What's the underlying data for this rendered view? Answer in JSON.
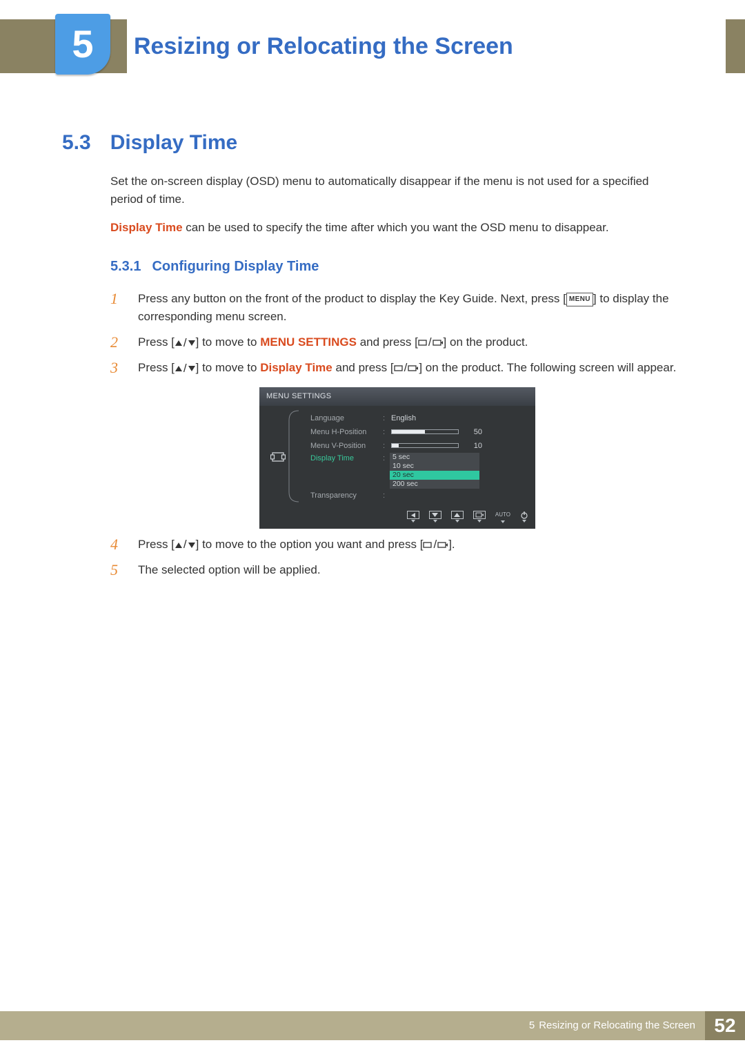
{
  "chapter": {
    "number": "5",
    "title": "Resizing or Relocating the Screen"
  },
  "section": {
    "number": "5.3",
    "title": "Display Time"
  },
  "intro1": "Set the on-screen display (OSD) menu to automatically disappear if the menu is not used for a specified period of time.",
  "intro2_prefix": "Display Time",
  "intro2_rest": " can be used to specify the time after which you want the OSD menu to disappear.",
  "subsection": {
    "number": "5.3.1",
    "title": "Configuring Display Time"
  },
  "menu_key_label": "MENU",
  "steps": {
    "s1_a": "Press any button on the front of the product to display the Key Guide. Next, press [",
    "s1_b": "] to display the corresponding menu screen.",
    "s2_a": "Press [",
    "s2_b": "] to move to ",
    "s2_hl": "MENU SETTINGS",
    "s2_c": " and press [",
    "s2_d": "] on the product.",
    "s3_a": "Press [",
    "s3_b": "] to move to ",
    "s3_hl": "Display Time",
    "s3_c": " and press [",
    "s3_d": "] on the product. The following screen will appear.",
    "s4_a": "Press [",
    "s4_b": "] to move to the option you want and press [",
    "s4_c": "].",
    "s5": "The selected option will be applied."
  },
  "step_nums": [
    "1",
    "2",
    "3",
    "4",
    "5"
  ],
  "osd": {
    "title": "MENU SETTINGS",
    "rows": {
      "language_label": "Language",
      "language_value": "English",
      "hpos_label": "Menu H-Position",
      "hpos_value": "50",
      "vpos_label": "Menu V-Position",
      "vpos_value": "10",
      "display_time_label": "Display Time",
      "transparency_label": "Transparency"
    },
    "options": [
      "5 sec",
      "10 sec",
      "20 sec",
      "200 sec"
    ],
    "selected_option_index": 2,
    "footer_auto": "AUTO"
  },
  "footer": {
    "chapter_num": "5",
    "chapter_title": "Resizing or Relocating the Screen",
    "page": "52"
  },
  "chart_data": {
    "type": "table",
    "title": "MENU SETTINGS OSD",
    "items": [
      {
        "label": "Language",
        "value": "English"
      },
      {
        "label": "Menu H-Position",
        "value": 50,
        "range": [
          0,
          100
        ]
      },
      {
        "label": "Menu V-Position",
        "value": 10,
        "range": [
          0,
          100
        ]
      },
      {
        "label": "Display Time",
        "options": [
          "5 sec",
          "10 sec",
          "20 sec",
          "200 sec"
        ],
        "selected": "20 sec"
      },
      {
        "label": "Transparency",
        "value": null
      }
    ]
  }
}
